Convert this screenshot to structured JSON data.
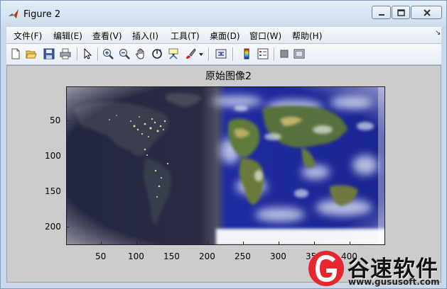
{
  "window": {
    "title": "Figure 2"
  },
  "menubar": {
    "items": [
      "文件(F)",
      "编辑(E)",
      "查看(V)",
      "插入(I)",
      "工具(T)",
      "桌面(D)",
      "窗口(W)",
      "帮助(H)"
    ],
    "overflow_icon": "chevron-arrow-icon"
  },
  "toolbar": {
    "icons": [
      "new-figure-icon",
      "open-file-icon",
      "save-icon",
      "print-icon",
      "pointer-icon",
      "zoom-in-icon",
      "zoom-out-icon",
      "pan-hand-icon",
      "rotate-3d-icon",
      "data-cursor-icon",
      "brush-icon",
      "brush-dropdown-icon",
      "link-plot-icon",
      "colorbar-icon",
      "legend-icon",
      "hide-plot-tools-icon",
      "show-plot-tools-icon"
    ]
  },
  "plot": {
    "title": "原始图像2",
    "image": "world-map-day-night",
    "y_ticks": [
      "50",
      "100",
      "150",
      "200"
    ],
    "x_ticks": [
      "50",
      "100",
      "150",
      "200",
      "250",
      "300",
      "350",
      "400"
    ]
  },
  "watermark": {
    "brand": "谷速软件",
    "url": "www.gususoft.com"
  }
}
